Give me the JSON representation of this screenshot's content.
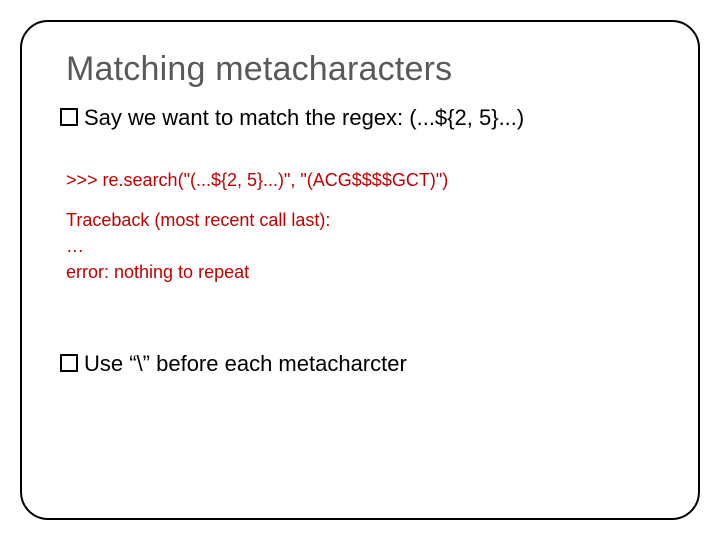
{
  "title": "Matching metacharacters",
  "bullet1": "Say we want to match the regex: (...${2, 5}...)",
  "code_line1": ">>> re.search(\"(...${2, 5}...)\", \"(ACG$$$$GCT)\")",
  "trace_line1": "Traceback (most recent call last):",
  "trace_line2": "…",
  "trace_line3": "error: nothing to repeat",
  "bullet2": "Use “\\” before each metacharcter"
}
